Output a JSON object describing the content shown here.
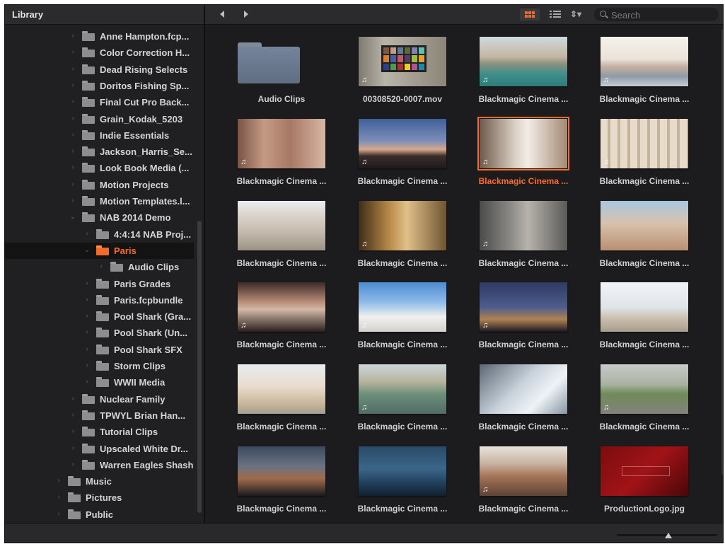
{
  "sidebar": {
    "title": "Library",
    "items": [
      {
        "label": "Anne Hampton.fcp...",
        "chevron": "›",
        "level": 0
      },
      {
        "label": "Color Correction H...",
        "chevron": "›",
        "level": 0
      },
      {
        "label": "Dead Rising Selects",
        "chevron": "›",
        "level": 0
      },
      {
        "label": "Doritos Fishing Sp...",
        "chevron": "›",
        "level": 0
      },
      {
        "label": "Final Cut Pro Back...",
        "chevron": "›",
        "level": 0
      },
      {
        "label": "Grain_Kodak_5203",
        "chevron": "›",
        "level": 0
      },
      {
        "label": "Indie Essentials",
        "chevron": "›",
        "level": 0
      },
      {
        "label": "Jackson_Harris_Se...",
        "chevron": "›",
        "level": 0
      },
      {
        "label": "Look Book Media (...",
        "chevron": "›",
        "level": 0
      },
      {
        "label": "Motion Projects",
        "chevron": "›",
        "level": 0
      },
      {
        "label": "Motion Templates.l...",
        "chevron": "›",
        "level": 0
      },
      {
        "label": "NAB 2014 Demo",
        "chevron": "⌄",
        "level": 0
      },
      {
        "label": "4:4:14 NAB Proj...",
        "chevron": "›",
        "level": 1
      },
      {
        "label": "Paris",
        "chevron": "⌄",
        "level": 1,
        "selected": true
      },
      {
        "label": "Audio Clips",
        "chevron": "›",
        "level": 2
      },
      {
        "label": "Paris Grades",
        "chevron": "›",
        "level": 1
      },
      {
        "label": "Paris.fcpbundle",
        "chevron": "›",
        "level": 1
      },
      {
        "label": "Pool Shark (Gra...",
        "chevron": "›",
        "level": 1
      },
      {
        "label": "Pool Shark (Un...",
        "chevron": "›",
        "level": 1
      },
      {
        "label": "Pool Shark SFX",
        "chevron": "›",
        "level": 1
      },
      {
        "label": "Storm Clips",
        "chevron": "›",
        "level": 1
      },
      {
        "label": "WWII Media",
        "chevron": "›",
        "level": 1
      },
      {
        "label": "Nuclear Family",
        "chevron": "›",
        "level": 0
      },
      {
        "label": "TPWYL Brian Han...",
        "chevron": "›",
        "level": 0
      },
      {
        "label": "Tutorial Clips",
        "chevron": "›",
        "level": 0
      },
      {
        "label": "Upscaled White Dr...",
        "chevron": "›",
        "level": 0
      },
      {
        "label": "Warren Eagles Shash",
        "chevron": "›",
        "level": 0
      },
      {
        "label": "Music",
        "chevron": "›",
        "level": -1
      },
      {
        "label": "Pictures",
        "chevron": "›",
        "level": -1
      },
      {
        "label": "Public",
        "chevron": "›",
        "level": -1
      }
    ]
  },
  "toolbar": {
    "search_placeholder": "Search",
    "sort_label": "⇕▾"
  },
  "grid": {
    "items": [
      {
        "label": "Audio Clips",
        "kind": "folder"
      },
      {
        "label": "00308520-0007.mov",
        "kind": "clip",
        "audio": true,
        "scene": "chart"
      },
      {
        "label": "Blackmagic Cinema ...",
        "kind": "clip",
        "audio": true,
        "scene": "river"
      },
      {
        "label": "Blackmagic Cinema ...",
        "kind": "clip",
        "audio": true,
        "scene": "bridge"
      },
      {
        "label": "Blackmagic Cinema ...",
        "kind": "clip",
        "audio": true,
        "scene": "facade"
      },
      {
        "label": "Blackmagic Cinema ...",
        "kind": "clip",
        "audio": true,
        "scene": "dusk"
      },
      {
        "label": "Blackmagic Cinema ...",
        "kind": "clip",
        "audio": true,
        "scene": "eiffel-street",
        "selected": true
      },
      {
        "label": "Blackmagic Cinema ...",
        "kind": "clip",
        "audio": true,
        "scene": "columns"
      },
      {
        "label": "Blackmagic Cinema ...",
        "kind": "clip",
        "audio": false,
        "scene": "plaza"
      },
      {
        "label": "Blackmagic Cinema ...",
        "kind": "clip",
        "audio": true,
        "scene": "gold"
      },
      {
        "label": "Blackmagic Cinema ...",
        "kind": "clip",
        "audio": true,
        "scene": "aerial"
      },
      {
        "label": "Blackmagic Cinema ...",
        "kind": "clip",
        "audio": false,
        "scene": "statue"
      },
      {
        "label": "Blackmagic Cinema ...",
        "kind": "clip",
        "audio": true,
        "scene": "sunset"
      },
      {
        "label": "Blackmagic Cinema ...",
        "kind": "clip",
        "audio": true,
        "scene": "basilica"
      },
      {
        "label": "Blackmagic Cinema ...",
        "kind": "clip",
        "audio": true,
        "scene": "night-tower"
      },
      {
        "label": "Blackmagic Cinema ...",
        "kind": "clip",
        "audio": false,
        "scene": "louvre"
      },
      {
        "label": "Blackmagic Cinema ...",
        "kind": "clip",
        "audio": false,
        "scene": "arch"
      },
      {
        "label": "Blackmagic Cinema ...",
        "kind": "clip",
        "audio": true,
        "scene": "vase"
      },
      {
        "label": "Blackmagic Cinema ...",
        "kind": "clip",
        "audio": false,
        "scene": "tower-up"
      },
      {
        "label": "Blackmagic Cinema ...",
        "kind": "clip",
        "audio": true,
        "scene": "champ"
      },
      {
        "label": "Blackmagic Cinema ...",
        "kind": "clip",
        "audio": false,
        "scene": "street-night"
      },
      {
        "label": "Blackmagic Cinema ...",
        "kind": "clip",
        "audio": false,
        "scene": "blue-river"
      },
      {
        "label": "Blackmagic Cinema ...",
        "kind": "clip",
        "audio": true,
        "scene": "tree"
      },
      {
        "label": "ProductionLogo.jpg",
        "kind": "clip",
        "audio": false,
        "scene": "logo"
      }
    ]
  },
  "colors": {
    "accent": "#f36b2a",
    "background": "#1c1c1e",
    "text": "#d0d0d0"
  },
  "icons": {
    "audio_badge": "♫"
  }
}
